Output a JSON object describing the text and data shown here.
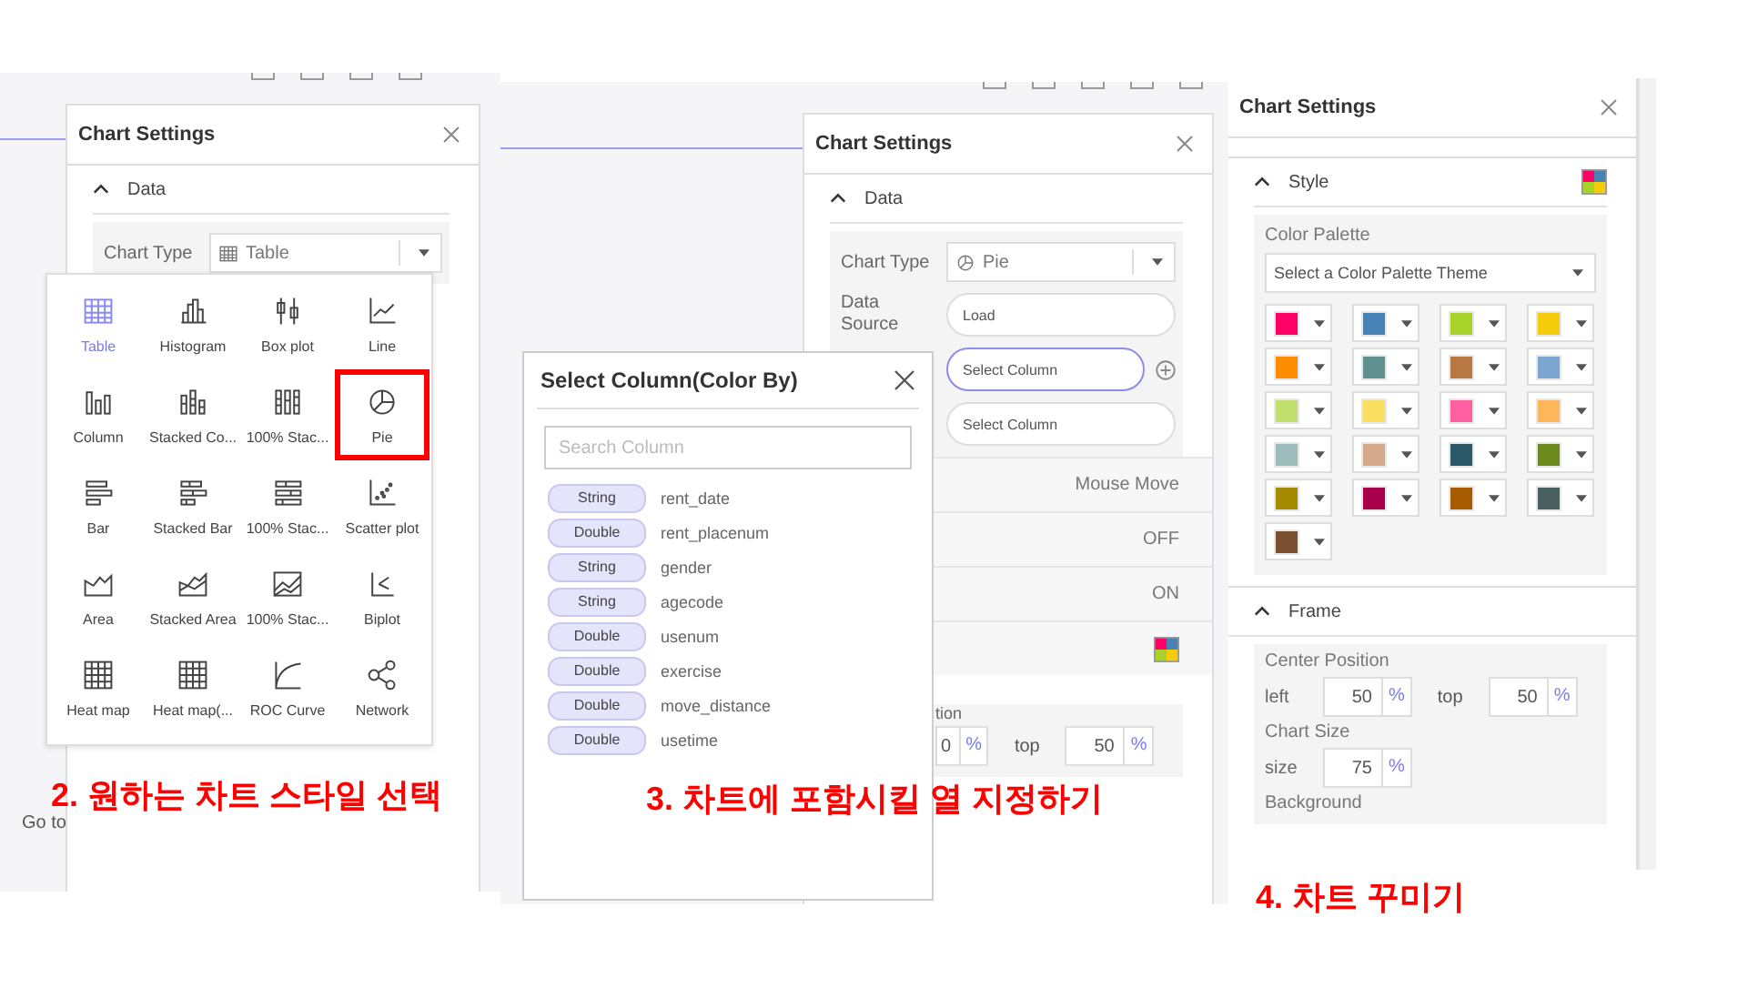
{
  "step_1": {
    "panel_title": "Chart Settings",
    "section": "Data",
    "chart_type_label": "Chart Type",
    "chart_type_value": "Table",
    "chart_types": [
      {
        "label": "Table",
        "kind": "table",
        "selected": true,
        "highlighted": false
      },
      {
        "label": "Histogram",
        "kind": "histogram",
        "selected": false,
        "highlighted": false
      },
      {
        "label": "Box plot",
        "kind": "boxplot",
        "selected": false,
        "highlighted": false
      },
      {
        "label": "Line",
        "kind": "line",
        "selected": false,
        "highlighted": false
      },
      {
        "label": "Column",
        "kind": "column",
        "selected": false,
        "highlighted": false
      },
      {
        "label": "Stacked Co...",
        "kind": "stacked-column",
        "selected": false,
        "highlighted": false
      },
      {
        "label": "100% Stac...",
        "kind": "percent-column",
        "selected": false,
        "highlighted": false
      },
      {
        "label": "Pie",
        "kind": "pie",
        "selected": false,
        "highlighted": true
      },
      {
        "label": "Bar",
        "kind": "bar",
        "selected": false,
        "highlighted": false
      },
      {
        "label": "Stacked Bar",
        "kind": "stacked-bar",
        "selected": false,
        "highlighted": false
      },
      {
        "label": "100% Stac...",
        "kind": "percent-bar",
        "selected": false,
        "highlighted": false
      },
      {
        "label": "Scatter plot",
        "kind": "scatter",
        "selected": false,
        "highlighted": false
      },
      {
        "label": "Area",
        "kind": "area",
        "selected": false,
        "highlighted": false
      },
      {
        "label": "Stacked Area",
        "kind": "stacked-area",
        "selected": false,
        "highlighted": false
      },
      {
        "label": "100% Stac...",
        "kind": "percent-area",
        "selected": false,
        "highlighted": false
      },
      {
        "label": "Biplot",
        "kind": "biplot",
        "selected": false,
        "highlighted": false
      },
      {
        "label": "Heat map",
        "kind": "heatmap",
        "selected": false,
        "highlighted": false
      },
      {
        "label": "Heat map(...",
        "kind": "heatmap",
        "selected": false,
        "highlighted": false
      },
      {
        "label": "ROC Curve",
        "kind": "roc",
        "selected": false,
        "highlighted": false
      },
      {
        "label": "Network",
        "kind": "network",
        "selected": false,
        "highlighted": false
      }
    ],
    "footer_link": "Go to",
    "caption": "2. 원하는 차트 스타일 선택"
  },
  "step_2": {
    "panel_title": "Chart Settings",
    "section": "Data",
    "chart_type_label": "Chart Type",
    "chart_type_value": "Pie",
    "data_source_label": "Data Source",
    "load_button": "Load",
    "column_pickers": [
      {
        "label": "Select Column",
        "selected": true
      },
      {
        "label": "Select Column",
        "selected": false
      }
    ],
    "option_rows": [
      {
        "kind": "text",
        "value": "Mouse Move"
      },
      {
        "kind": "text",
        "value": "OFF"
      },
      {
        "kind": "text",
        "value": "ON"
      },
      {
        "kind": "palette"
      }
    ],
    "position_label": "tion",
    "left_value": "0",
    "left_unit": "%",
    "top_label": "top",
    "top_value": "50",
    "top_unit": "%",
    "dialog": {
      "title": "Select Column(Color By)",
      "search_placeholder": "Search Column",
      "columns": [
        {
          "type": "String",
          "name": "rent_date"
        },
        {
          "type": "Double",
          "name": "rent_placenum"
        },
        {
          "type": "String",
          "name": "gender"
        },
        {
          "type": "String",
          "name": "agecode"
        },
        {
          "type": "Double",
          "name": "usenum"
        },
        {
          "type": "Double",
          "name": "exercise"
        },
        {
          "type": "Double",
          "name": "move_distance"
        },
        {
          "type": "Double",
          "name": "usetime"
        }
      ]
    },
    "caption": "3. 차트에 포함시킬 열 지정하기"
  },
  "step_3": {
    "panel_title": "Chart Settings",
    "style_section": "Style",
    "palette_label": "Color Palette",
    "palette_placeholder": "Select a Color Palette Theme",
    "swatches": [
      {
        "color": "#ff0066"
      },
      {
        "color": "#4682b4"
      },
      {
        "color": "#a6d22a"
      },
      {
        "color": "#f5cc0a"
      },
      {
        "color": "#ff8c00"
      },
      {
        "color": "#5f9090"
      },
      {
        "color": "#b87843"
      },
      {
        "color": "#7ba6d0"
      },
      {
        "color": "#c2e070"
      },
      {
        "color": "#fbdf60"
      },
      {
        "color": "#ff5fa0"
      },
      {
        "color": "#ffb55a"
      },
      {
        "color": "#9dbcbc"
      },
      {
        "color": "#d4a889"
      },
      {
        "color": "#2c5a6a"
      },
      {
        "color": "#6a8a1e"
      },
      {
        "color": "#a58a00"
      },
      {
        "color": "#a8004a"
      },
      {
        "color": "#a85c00"
      },
      {
        "color": "#4a6060"
      },
      {
        "color": "#7a5030"
      }
    ],
    "frame_section": "Frame",
    "center_label": "Center Position",
    "left_label": "left",
    "left_value": "50",
    "top_label": "top",
    "top_value": "50",
    "unit": "%",
    "size_title": "Chart Size",
    "size_label": "size",
    "size_value": "75",
    "background_label": "Background",
    "caption": "4. 차트 꾸미기"
  }
}
